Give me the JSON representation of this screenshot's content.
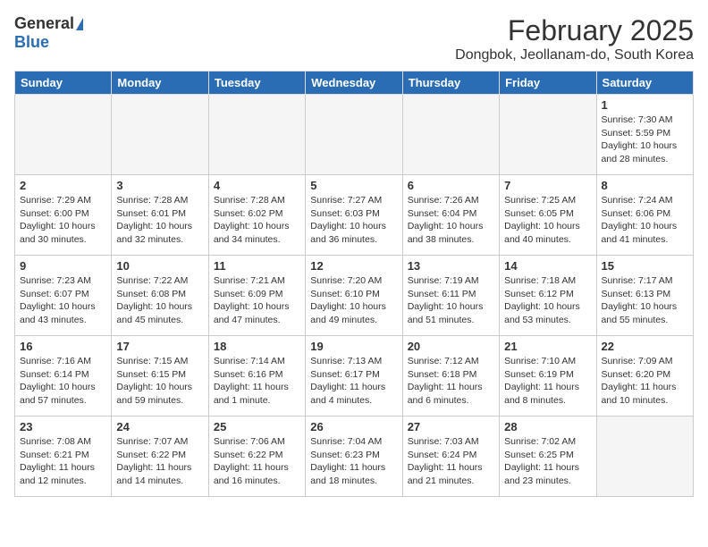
{
  "header": {
    "logo_general": "General",
    "logo_blue": "Blue",
    "month_title": "February 2025",
    "location": "Dongbok, Jeollanam-do, South Korea"
  },
  "days_of_week": [
    "Sunday",
    "Monday",
    "Tuesday",
    "Wednesday",
    "Thursday",
    "Friday",
    "Saturday"
  ],
  "weeks": [
    [
      {
        "day": "",
        "info": ""
      },
      {
        "day": "",
        "info": ""
      },
      {
        "day": "",
        "info": ""
      },
      {
        "day": "",
        "info": ""
      },
      {
        "day": "",
        "info": ""
      },
      {
        "day": "",
        "info": ""
      },
      {
        "day": "1",
        "info": "Sunrise: 7:30 AM\nSunset: 5:59 PM\nDaylight: 10 hours\nand 28 minutes."
      }
    ],
    [
      {
        "day": "2",
        "info": "Sunrise: 7:29 AM\nSunset: 6:00 PM\nDaylight: 10 hours\nand 30 minutes."
      },
      {
        "day": "3",
        "info": "Sunrise: 7:28 AM\nSunset: 6:01 PM\nDaylight: 10 hours\nand 32 minutes."
      },
      {
        "day": "4",
        "info": "Sunrise: 7:28 AM\nSunset: 6:02 PM\nDaylight: 10 hours\nand 34 minutes."
      },
      {
        "day": "5",
        "info": "Sunrise: 7:27 AM\nSunset: 6:03 PM\nDaylight: 10 hours\nand 36 minutes."
      },
      {
        "day": "6",
        "info": "Sunrise: 7:26 AM\nSunset: 6:04 PM\nDaylight: 10 hours\nand 38 minutes."
      },
      {
        "day": "7",
        "info": "Sunrise: 7:25 AM\nSunset: 6:05 PM\nDaylight: 10 hours\nand 40 minutes."
      },
      {
        "day": "8",
        "info": "Sunrise: 7:24 AM\nSunset: 6:06 PM\nDaylight: 10 hours\nand 41 minutes."
      }
    ],
    [
      {
        "day": "9",
        "info": "Sunrise: 7:23 AM\nSunset: 6:07 PM\nDaylight: 10 hours\nand 43 minutes."
      },
      {
        "day": "10",
        "info": "Sunrise: 7:22 AM\nSunset: 6:08 PM\nDaylight: 10 hours\nand 45 minutes."
      },
      {
        "day": "11",
        "info": "Sunrise: 7:21 AM\nSunset: 6:09 PM\nDaylight: 10 hours\nand 47 minutes."
      },
      {
        "day": "12",
        "info": "Sunrise: 7:20 AM\nSunset: 6:10 PM\nDaylight: 10 hours\nand 49 minutes."
      },
      {
        "day": "13",
        "info": "Sunrise: 7:19 AM\nSunset: 6:11 PM\nDaylight: 10 hours\nand 51 minutes."
      },
      {
        "day": "14",
        "info": "Sunrise: 7:18 AM\nSunset: 6:12 PM\nDaylight: 10 hours\nand 53 minutes."
      },
      {
        "day": "15",
        "info": "Sunrise: 7:17 AM\nSunset: 6:13 PM\nDaylight: 10 hours\nand 55 minutes."
      }
    ],
    [
      {
        "day": "16",
        "info": "Sunrise: 7:16 AM\nSunset: 6:14 PM\nDaylight: 10 hours\nand 57 minutes."
      },
      {
        "day": "17",
        "info": "Sunrise: 7:15 AM\nSunset: 6:15 PM\nDaylight: 10 hours\nand 59 minutes."
      },
      {
        "day": "18",
        "info": "Sunrise: 7:14 AM\nSunset: 6:16 PM\nDaylight: 11 hours\nand 1 minute."
      },
      {
        "day": "19",
        "info": "Sunrise: 7:13 AM\nSunset: 6:17 PM\nDaylight: 11 hours\nand 4 minutes."
      },
      {
        "day": "20",
        "info": "Sunrise: 7:12 AM\nSunset: 6:18 PM\nDaylight: 11 hours\nand 6 minutes."
      },
      {
        "day": "21",
        "info": "Sunrise: 7:10 AM\nSunset: 6:19 PM\nDaylight: 11 hours\nand 8 minutes."
      },
      {
        "day": "22",
        "info": "Sunrise: 7:09 AM\nSunset: 6:20 PM\nDaylight: 11 hours\nand 10 minutes."
      }
    ],
    [
      {
        "day": "23",
        "info": "Sunrise: 7:08 AM\nSunset: 6:21 PM\nDaylight: 11 hours\nand 12 minutes."
      },
      {
        "day": "24",
        "info": "Sunrise: 7:07 AM\nSunset: 6:22 PM\nDaylight: 11 hours\nand 14 minutes."
      },
      {
        "day": "25",
        "info": "Sunrise: 7:06 AM\nSunset: 6:22 PM\nDaylight: 11 hours\nand 16 minutes."
      },
      {
        "day": "26",
        "info": "Sunrise: 7:04 AM\nSunset: 6:23 PM\nDaylight: 11 hours\nand 18 minutes."
      },
      {
        "day": "27",
        "info": "Sunrise: 7:03 AM\nSunset: 6:24 PM\nDaylight: 11 hours\nand 21 minutes."
      },
      {
        "day": "28",
        "info": "Sunrise: 7:02 AM\nSunset: 6:25 PM\nDaylight: 11 hours\nand 23 minutes."
      },
      {
        "day": "",
        "info": ""
      }
    ]
  ]
}
